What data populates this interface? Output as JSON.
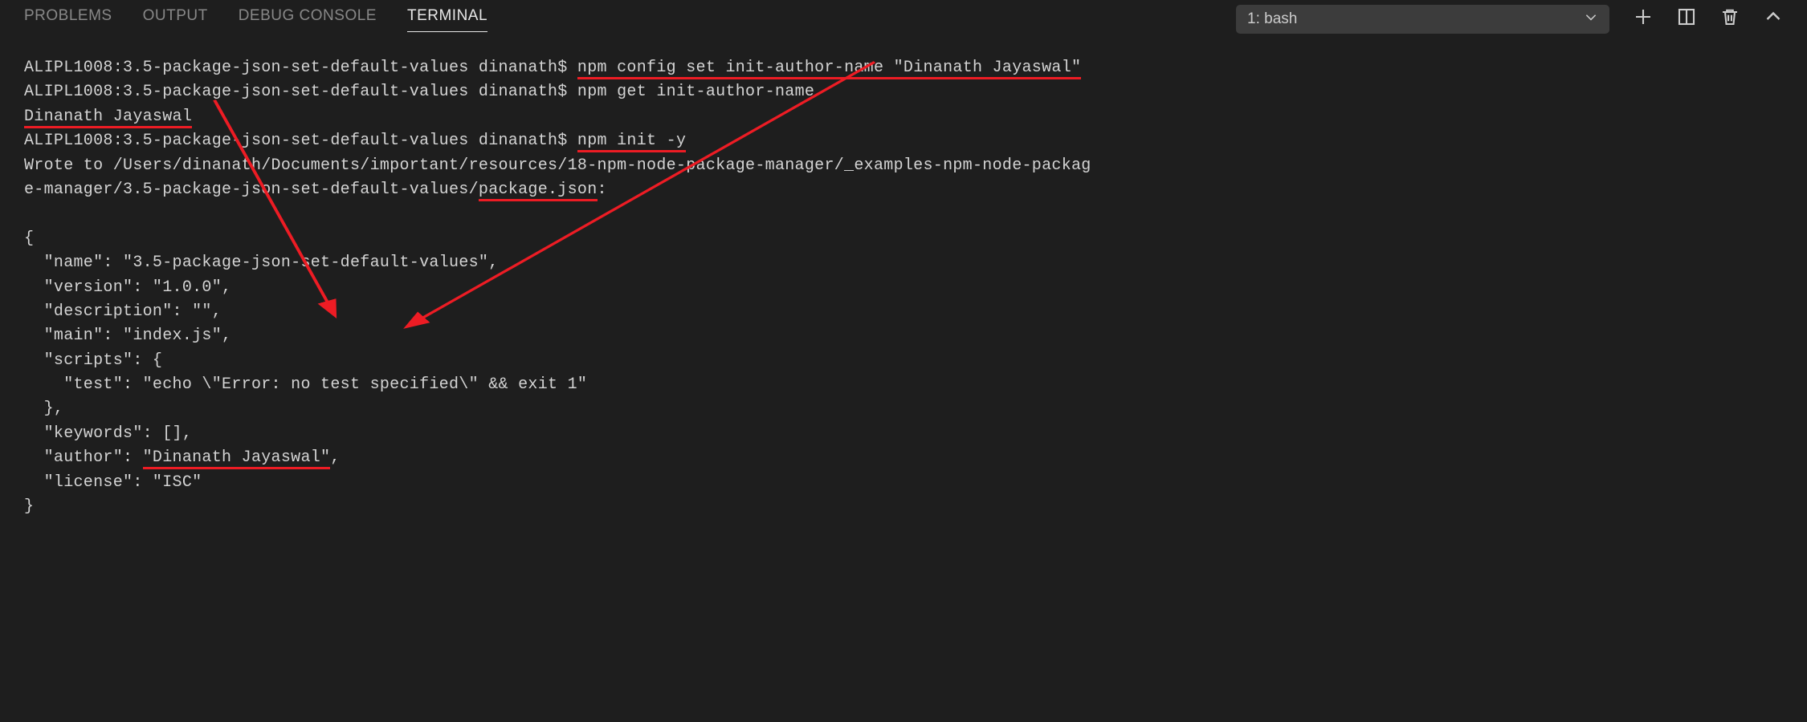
{
  "header": {
    "tabs": [
      {
        "label": "PROBLEMS",
        "active": false
      },
      {
        "label": "OUTPUT",
        "active": false
      },
      {
        "label": "DEBUG CONSOLE",
        "active": false
      },
      {
        "label": "TERMINAL",
        "active": true
      }
    ],
    "dropdown": {
      "selected": "1: bash"
    },
    "colors": {
      "underline": "#ed1c24",
      "background": "#1e1e1e",
      "text": "#d4d4d4"
    }
  },
  "terminal": {
    "prompt": "ALIPL1008:3.5-package-json-set-default-values dinanath$ ",
    "cmd1": "npm config set init-author-name \"Dinanath Jayaswal\"",
    "cmd2_pre": "npm get init-author-name",
    "cmd2_output": "Dinanath Jayaswal",
    "cmd3": "npm init -y",
    "wrote_line1": "Wrote to /Users/dinanath/Documents/important/resources/18-npm-node-package-manager/_examples-npm-node-packag",
    "wrote_line2_pre": "e-manager/3.5-package-json-set-default-values/",
    "wrote_line2_file": "package.json",
    "wrote_line2_post": ":",
    "json": {
      "open": "{",
      "l1": "  \"name\": \"3.5-package-json-set-default-values\",",
      "l2": "  \"version\": \"1.0.0\",",
      "l3": "  \"description\": \"\",",
      "l4": "  \"main\": \"index.js\",",
      "l5": "  \"scripts\": {",
      "l6": "    \"test\": \"echo \\\"Error: no test specified\\\" && exit 1\"",
      "l7": "  },",
      "l8": "  \"keywords\": [],",
      "l9_pre": "  \"author\": ",
      "l9_val": "\"Dinanath Jayaswal\"",
      "l9_post": ",",
      "l10": "  \"license\": \"ISC\"",
      "close": "}"
    }
  }
}
